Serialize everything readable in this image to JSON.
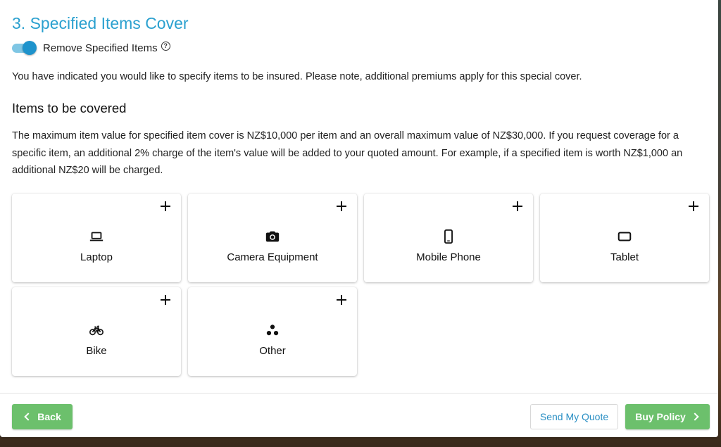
{
  "section": {
    "title": "3. Specified Items Cover",
    "toggle_label": "Remove Specified Items",
    "toggle_on": true,
    "intro": "You have indicated you would like to specify items to be insured. Please note, additional premiums apply for this special cover."
  },
  "items_section": {
    "heading": "Items to be covered",
    "description": "The maximum item value for specified item cover is NZ$10,000 per item and an overall maximum value of NZ$30,000. If you request coverage for a specific item, an additional 2% charge of the item's value will be added to your quoted amount. For example, if a specified item is worth NZ$1,000 an additional NZ$20 will be charged."
  },
  "items": [
    {
      "label": "Laptop",
      "icon": "laptop-icon"
    },
    {
      "label": "Camera Equipment",
      "icon": "camera-icon"
    },
    {
      "label": "Mobile Phone",
      "icon": "mobile-phone-icon"
    },
    {
      "label": "Tablet",
      "icon": "tablet-icon"
    },
    {
      "label": "Bike",
      "icon": "bike-icon"
    },
    {
      "label": "Other",
      "icon": "other-icon"
    }
  ],
  "footer": {
    "back_label": "Back",
    "send_quote_label": "Send My Quote",
    "buy_policy_label": "Buy Policy"
  },
  "colors": {
    "title": "#2aa0cf",
    "toggle": "#1e93cc",
    "green_button": "#6cc06c",
    "link_blue": "#2a8fc4"
  }
}
